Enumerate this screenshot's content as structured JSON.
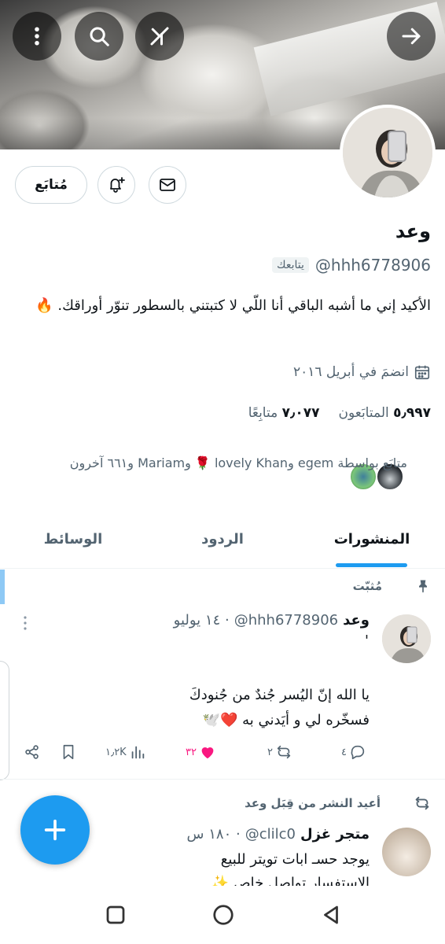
{
  "header": {
    "icons": [
      "back-arrow-icon",
      "grok-icon",
      "search-icon",
      "more-icon"
    ]
  },
  "profile": {
    "name": "وعد",
    "handle": "@hhh6778906",
    "follows_you": "يتابعك",
    "bio": "الأكيد إني ما أشبه الباقي أنا اللّي  لا كتبتني بالسطور تنوّر أوراقك. 🔥",
    "joined": "انضمَ في أبريل ٢٠١٦",
    "followers_count": "٥٫٩٩٧",
    "followers_label": "المتابَعون",
    "following_count": "٧٫٠٧٧",
    "following_label": "متابِعًا",
    "followed_by": "متابَع بواسطة egem وlovely Khan 🌹 وMariam و٦٦١ آخرون",
    "follow_button": "مُتابَع"
  },
  "tabs": [
    "المنشورات",
    "الردود",
    "الوسائط"
  ],
  "pinned_tweet": {
    "pinned_label": "مُثبّت",
    "author": "وعد",
    "handle": "@hhh6778906",
    "date": "· ١٤ يوليو",
    "line_mark": "'",
    "text_line1": "يا الله إنّ اليُسر جُندٌ من جُنودكَ",
    "text_line2": "فسخّره لي و أيَدني به ❤️🕊️",
    "replies": "٤",
    "retweets": "٢",
    "likes": "٣٢",
    "views": "١٫٢K"
  },
  "retweet": {
    "rt_label": "أعيد النشر من قِبَل وعد",
    "author": "متجر غزل",
    "handle": "@clilc0",
    "time": "· ١٨٠ س",
    "text_line1": "يوجد حسـ ابات تويتر للبيع",
    "text_line2": "الاستفسار تواصل خاص ✨"
  },
  "colors": {
    "accent": "#1d9bf0",
    "like": "#f91880",
    "muted": "#536471"
  }
}
